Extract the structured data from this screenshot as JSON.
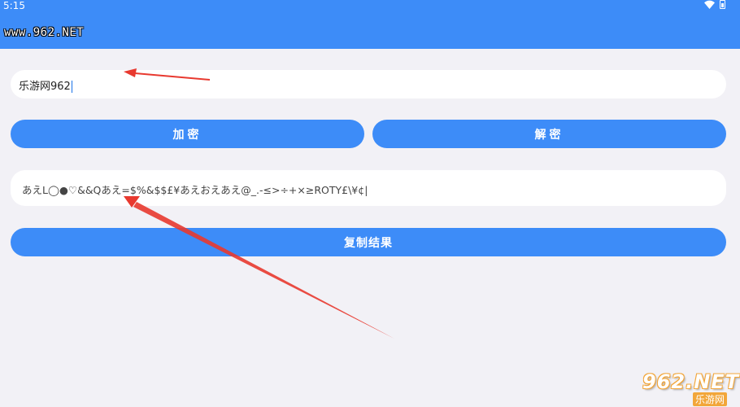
{
  "status_bar": {
    "time": "5:15",
    "icons": [
      "wifi-icon",
      "battery-icon"
    ]
  },
  "app_bar": {
    "title": "www.962.NET"
  },
  "input": {
    "value": "乐游网962"
  },
  "buttons": {
    "encrypt": "加密",
    "decrypt": "解密",
    "copy": "复制结果"
  },
  "output": {
    "value": "あえL◯●♡&&Qあえ=$%&$$£¥あえおえあえ@_.-≤>÷+×≥ROTY£\\¥¢|"
  },
  "watermark": {
    "logo": "962.NET",
    "sub": "乐游网"
  },
  "colors": {
    "primary": "#3d8cf8",
    "background": "#f2f1f6",
    "arrow": "#e8392f"
  }
}
